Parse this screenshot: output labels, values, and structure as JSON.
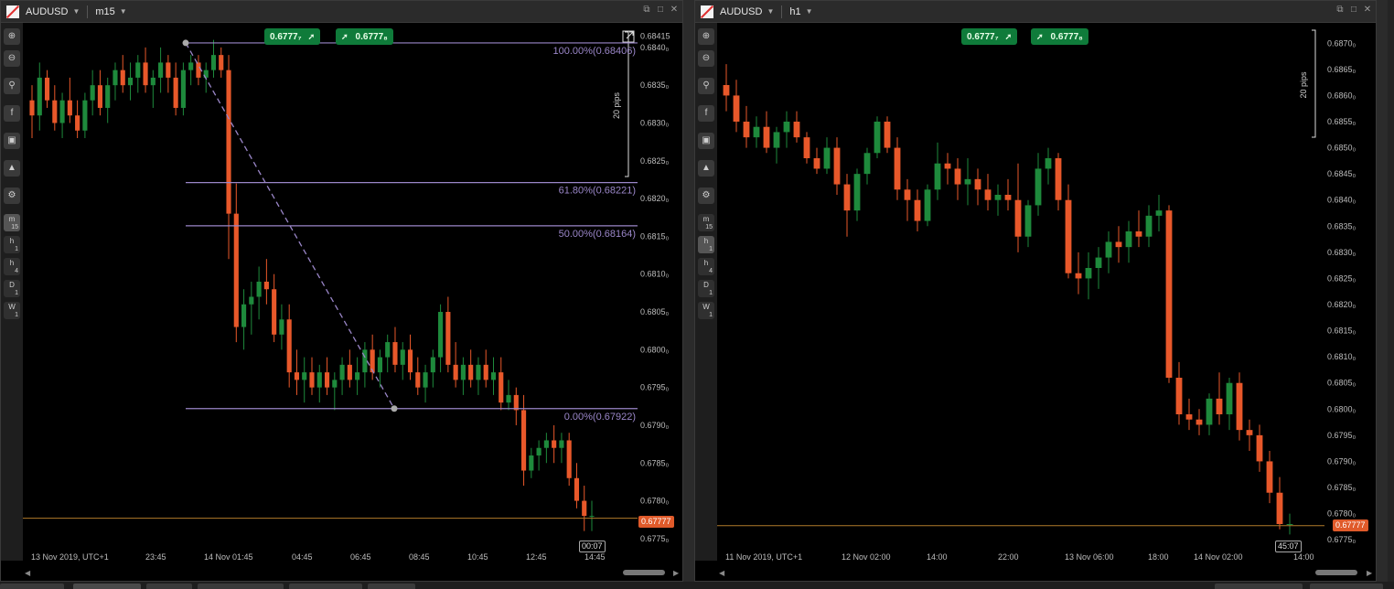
{
  "left_panel": {
    "symbol": "AUDUSD",
    "timeframe": "m15",
    "bid_badge": "0.6777₇",
    "ask_badge": "0.6777₈",
    "pips_label": "20 pips",
    "price_axis": [
      "0.68415",
      "0.6840₀",
      "0.6835₀",
      "0.6830₀",
      "0.6825₀",
      "0.6820₀",
      "0.6815₀",
      "0.6810₀",
      "0.6805₀",
      "0.6800₀",
      "0.6795₀",
      "0.6790₀",
      "0.6785₀",
      "0.6780₀",
      "0.6775₀"
    ],
    "time_axis": [
      "13 Nov 2019, UTC+1",
      "23:45",
      "14 Nov 01:45",
      "04:45",
      "06:45",
      "08:45",
      "10:45",
      "12:45",
      "14:45"
    ],
    "fib_levels": [
      "100.00%(0.68406)",
      "61.80%(0.68221)",
      "50.00%(0.68164)",
      "0.00%(0.67922)"
    ],
    "last_price": "0.67777",
    "countdown": "00:07"
  },
  "right_panel": {
    "symbol": "AUDUSD",
    "timeframe": "h1",
    "bid_badge": "0.6777₇",
    "ask_badge": "0.6777₈",
    "pips_label": "20 pips",
    "price_axis": [
      "0.6870₀",
      "0.6865₀",
      "0.6860₀",
      "0.6855₀",
      "0.6850₀",
      "0.6845₀",
      "0.6840₀",
      "0.6835₀",
      "0.6830₀",
      "0.6825₀",
      "0.6820₀",
      "0.6815₀",
      "0.6810₀",
      "0.6805₀",
      "0.6800₀",
      "0.6795₀",
      "0.6790₀",
      "0.6785₀",
      "0.6780₀",
      "0.6775₀"
    ],
    "time_axis": [
      "11 Nov 2019, UTC+1",
      "12 Nov 02:00",
      "14:00",
      "22:00",
      "13 Nov 06:00",
      "18:00",
      "14 Nov 02:00",
      "14:00"
    ],
    "last_price": "0.67777",
    "countdown": "45:07"
  },
  "toolbar": {
    "tools": [
      "zoom-in-icon",
      "zoom-out-icon",
      "indicators-icon",
      "facebook-icon",
      "robot-icon",
      "drawing-icon",
      "chart-settings-icon"
    ],
    "timeframes": [
      {
        "top": "m",
        "bottom": "15"
      },
      {
        "top": "h",
        "bottom": "1"
      },
      {
        "top": "h",
        "bottom": "4"
      },
      {
        "top": "D",
        "bottom": "1"
      },
      {
        "top": "W",
        "bottom": "1"
      }
    ]
  },
  "colors": {
    "bull": "#1e8a3c",
    "bear": "#e8582a",
    "fib": "#9a86c8",
    "price_line": "#b07a2a",
    "badge": "#0f7b3a"
  },
  "chart_data": [
    {
      "type": "candlestick",
      "symbol": "AUDUSD",
      "timeframe": "m15",
      "ylim": [
        0.67745,
        0.68418
      ],
      "fib_retracement": {
        "high": 0.68406,
        "low": 0.67922,
        "levels": [
          1.0,
          0.618,
          0.5,
          0.0
        ]
      },
      "last_price": 0.67777,
      "ohlc": [
        [
          0.6833,
          0.6835,
          0.6828,
          0.6831
        ],
        [
          0.6831,
          0.6838,
          0.6829,
          0.6836
        ],
        [
          0.6836,
          0.6837,
          0.6832,
          0.6833
        ],
        [
          0.6833,
          0.6835,
          0.6829,
          0.683
        ],
        [
          0.683,
          0.6834,
          0.6828,
          0.6833
        ],
        [
          0.6833,
          0.6836,
          0.683,
          0.6831
        ],
        [
          0.6831,
          0.6833,
          0.6828,
          0.6829
        ],
        [
          0.6829,
          0.6834,
          0.6828,
          0.6833
        ],
        [
          0.6833,
          0.6837,
          0.6831,
          0.6835
        ],
        [
          0.6835,
          0.6837,
          0.6831,
          0.6832
        ],
        [
          0.6832,
          0.6836,
          0.683,
          0.6835
        ],
        [
          0.6835,
          0.6838,
          0.6833,
          0.6837
        ],
        [
          0.6837,
          0.6839,
          0.6834,
          0.6835
        ],
        [
          0.6835,
          0.6838,
          0.6833,
          0.6836
        ],
        [
          0.6836,
          0.6839,
          0.6834,
          0.6838
        ],
        [
          0.6838,
          0.684,
          0.6834,
          0.6835
        ],
        [
          0.6835,
          0.6837,
          0.6832,
          0.6836
        ],
        [
          0.6836,
          0.684,
          0.6834,
          0.6838
        ],
        [
          0.6838,
          0.6839,
          0.6834,
          0.6836
        ],
        [
          0.6836,
          0.6838,
          0.6831,
          0.6832
        ],
        [
          0.6832,
          0.6838,
          0.6831,
          0.6837
        ],
        [
          0.6837,
          0.6839,
          0.6835,
          0.6838
        ],
        [
          0.6838,
          0.6839,
          0.6835,
          0.6836
        ],
        [
          0.6836,
          0.6838,
          0.6834,
          0.6837
        ],
        [
          0.6837,
          0.6841,
          0.6836,
          0.6839
        ],
        [
          0.6839,
          0.684,
          0.6836,
          0.6837
        ],
        [
          0.6837,
          0.6839,
          0.6812,
          0.6818
        ],
        [
          0.6818,
          0.6822,
          0.6801,
          0.6803
        ],
        [
          0.6803,
          0.6808,
          0.68,
          0.6806
        ],
        [
          0.6806,
          0.6809,
          0.6802,
          0.6807
        ],
        [
          0.6807,
          0.6811,
          0.6804,
          0.6809
        ],
        [
          0.6809,
          0.6812,
          0.6806,
          0.6808
        ],
        [
          0.6808,
          0.681,
          0.6801,
          0.6802
        ],
        [
          0.6802,
          0.6806,
          0.68,
          0.6804
        ],
        [
          0.6804,
          0.6806,
          0.6795,
          0.6797
        ],
        [
          0.6797,
          0.68,
          0.6794,
          0.6796
        ],
        [
          0.6796,
          0.6799,
          0.6793,
          0.6797
        ],
        [
          0.6797,
          0.6799,
          0.6794,
          0.6795
        ],
        [
          0.6795,
          0.6798,
          0.6793,
          0.6797
        ],
        [
          0.6797,
          0.6799,
          0.6794,
          0.6795
        ],
        [
          0.6795,
          0.6797,
          0.6792,
          0.6796
        ],
        [
          0.6796,
          0.6799,
          0.6794,
          0.6798
        ],
        [
          0.6798,
          0.68,
          0.6795,
          0.6796
        ],
        [
          0.6796,
          0.6799,
          0.6794,
          0.6797
        ],
        [
          0.6797,
          0.6801,
          0.6795,
          0.68
        ],
        [
          0.68,
          0.6802,
          0.6796,
          0.6797
        ],
        [
          0.6797,
          0.68,
          0.6795,
          0.6799
        ],
        [
          0.6799,
          0.6802,
          0.6797,
          0.6801
        ],
        [
          0.6801,
          0.6803,
          0.6797,
          0.6798
        ],
        [
          0.6798,
          0.6801,
          0.6796,
          0.68
        ],
        [
          0.68,
          0.6802,
          0.6796,
          0.6797
        ],
        [
          0.6797,
          0.6799,
          0.6794,
          0.6795
        ],
        [
          0.6795,
          0.6798,
          0.6793,
          0.6797
        ],
        [
          0.6797,
          0.68,
          0.6795,
          0.6799
        ],
        [
          0.6799,
          0.6806,
          0.6797,
          0.6805
        ],
        [
          0.6805,
          0.6807,
          0.6797,
          0.6798
        ],
        [
          0.6798,
          0.6801,
          0.6795,
          0.6796
        ],
        [
          0.6796,
          0.6799,
          0.6794,
          0.6798
        ],
        [
          0.6798,
          0.68,
          0.6795,
          0.6796
        ],
        [
          0.6796,
          0.6799,
          0.6794,
          0.6798
        ],
        [
          0.6798,
          0.68,
          0.6795,
          0.6796
        ],
        [
          0.6796,
          0.6799,
          0.6794,
          0.6797
        ],
        [
          0.6797,
          0.6799,
          0.6792,
          0.6793
        ],
        [
          0.6793,
          0.6796,
          0.6792,
          0.6794
        ],
        [
          0.6794,
          0.6795,
          0.679,
          0.6792
        ],
        [
          0.6792,
          0.6794,
          0.6782,
          0.6784
        ],
        [
          0.6784,
          0.6787,
          0.6783,
          0.6786
        ],
        [
          0.6786,
          0.6788,
          0.6784,
          0.6787
        ],
        [
          0.6787,
          0.6789,
          0.6785,
          0.6788
        ],
        [
          0.6788,
          0.679,
          0.6785,
          0.6787
        ],
        [
          0.6787,
          0.6789,
          0.6785,
          0.6788
        ],
        [
          0.6788,
          0.6789,
          0.6782,
          0.6783
        ],
        [
          0.6783,
          0.6785,
          0.6779,
          0.678
        ],
        [
          0.678,
          0.6782,
          0.6776,
          0.6778
        ],
        [
          0.6778,
          0.678,
          0.6776,
          0.6778
        ]
      ]
    },
    {
      "type": "candlestick",
      "symbol": "AUDUSD",
      "timeframe": "h1",
      "ylim": [
        0.67745,
        0.68718
      ],
      "last_price": 0.67777,
      "ohlc": [
        [
          0.6862,
          0.6866,
          0.6857,
          0.686
        ],
        [
          0.686,
          0.6863,
          0.6853,
          0.6855
        ],
        [
          0.6855,
          0.6858,
          0.685,
          0.6852
        ],
        [
          0.6852,
          0.6856,
          0.685,
          0.6854
        ],
        [
          0.6854,
          0.6857,
          0.6849,
          0.685
        ],
        [
          0.685,
          0.6854,
          0.6847,
          0.6853
        ],
        [
          0.6853,
          0.6857,
          0.685,
          0.6855
        ],
        [
          0.6855,
          0.6857,
          0.6851,
          0.6852
        ],
        [
          0.6852,
          0.6853,
          0.6847,
          0.6848
        ],
        [
          0.6848,
          0.685,
          0.6845,
          0.6846
        ],
        [
          0.6846,
          0.6852,
          0.6845,
          0.685
        ],
        [
          0.685,
          0.6852,
          0.6841,
          0.6843
        ],
        [
          0.6843,
          0.6845,
          0.6833,
          0.6838
        ],
        [
          0.6838,
          0.6846,
          0.6836,
          0.6845
        ],
        [
          0.6845,
          0.685,
          0.6843,
          0.6849
        ],
        [
          0.6849,
          0.6856,
          0.6848,
          0.6855
        ],
        [
          0.6855,
          0.6856,
          0.6849,
          0.685
        ],
        [
          0.685,
          0.6852,
          0.684,
          0.6842
        ],
        [
          0.6842,
          0.6844,
          0.6836,
          0.684
        ],
        [
          0.684,
          0.6842,
          0.6834,
          0.6836
        ],
        [
          0.6836,
          0.6843,
          0.6835,
          0.6842
        ],
        [
          0.6842,
          0.6851,
          0.684,
          0.6847
        ],
        [
          0.6847,
          0.6849,
          0.6843,
          0.6846
        ],
        [
          0.6846,
          0.6848,
          0.684,
          0.6843
        ],
        [
          0.6843,
          0.6848,
          0.6839,
          0.6844
        ],
        [
          0.6844,
          0.6846,
          0.6839,
          0.6842
        ],
        [
          0.6842,
          0.6845,
          0.6838,
          0.684
        ],
        [
          0.684,
          0.6843,
          0.6837,
          0.6841
        ],
        [
          0.6841,
          0.6844,
          0.6838,
          0.684
        ],
        [
          0.684,
          0.6847,
          0.683,
          0.6833
        ],
        [
          0.6833,
          0.684,
          0.6831,
          0.6839
        ],
        [
          0.6839,
          0.6849,
          0.6837,
          0.6846
        ],
        [
          0.6846,
          0.685,
          0.6843,
          0.6848
        ],
        [
          0.6848,
          0.6849,
          0.6838,
          0.684
        ],
        [
          0.684,
          0.6843,
          0.6825,
          0.6826
        ],
        [
          0.6826,
          0.683,
          0.6822,
          0.6825
        ],
        [
          0.6825,
          0.683,
          0.6821,
          0.6827
        ],
        [
          0.6827,
          0.6831,
          0.6823,
          0.6829
        ],
        [
          0.6829,
          0.6834,
          0.6826,
          0.6832
        ],
        [
          0.6832,
          0.6835,
          0.6828,
          0.6831
        ],
        [
          0.6831,
          0.6836,
          0.6828,
          0.6834
        ],
        [
          0.6834,
          0.6838,
          0.6831,
          0.6833
        ],
        [
          0.6833,
          0.6839,
          0.6831,
          0.6837
        ],
        [
          0.6837,
          0.6841,
          0.6834,
          0.6838
        ],
        [
          0.6838,
          0.6839,
          0.6805,
          0.6806
        ],
        [
          0.6806,
          0.6809,
          0.6797,
          0.6799
        ],
        [
          0.6799,
          0.6802,
          0.6796,
          0.6798
        ],
        [
          0.6798,
          0.68,
          0.6795,
          0.6797
        ],
        [
          0.6797,
          0.6803,
          0.6795,
          0.6802
        ],
        [
          0.6802,
          0.6807,
          0.6797,
          0.6799
        ],
        [
          0.6799,
          0.6806,
          0.6796,
          0.6805
        ],
        [
          0.6805,
          0.6807,
          0.6794,
          0.6796
        ],
        [
          0.6796,
          0.6798,
          0.6792,
          0.6795
        ],
        [
          0.6795,
          0.6797,
          0.6788,
          0.679
        ],
        [
          0.679,
          0.6792,
          0.6782,
          0.6784
        ],
        [
          0.6784,
          0.6787,
          0.6777,
          0.6778
        ],
        [
          0.6778,
          0.678,
          0.6776,
          0.6778
        ]
      ]
    }
  ]
}
